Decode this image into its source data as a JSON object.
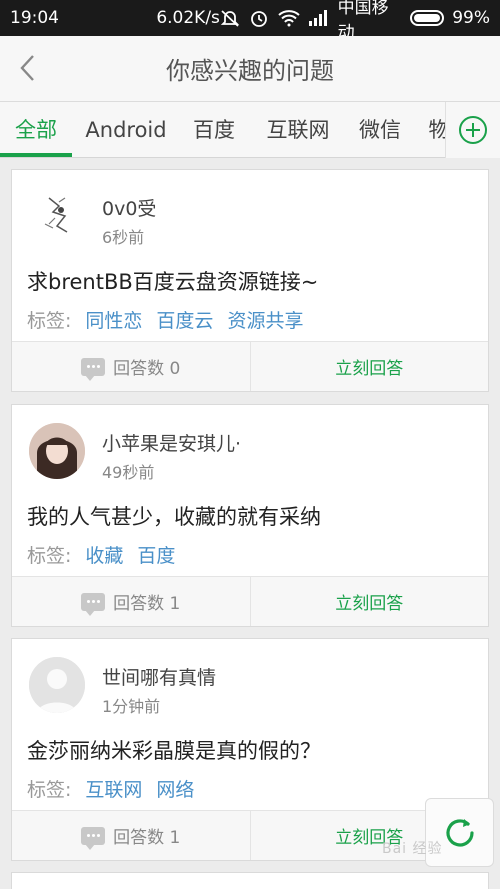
{
  "status_bar": {
    "time": "19:04",
    "speed": "6.02K/s",
    "carrier": "中国移动",
    "battery": "99%"
  },
  "header": {
    "title": "你感兴趣的问题"
  },
  "tabs": [
    {
      "label": "全部",
      "active": true
    },
    {
      "label": "Android"
    },
    {
      "label": "百度"
    },
    {
      "label": "互联网"
    },
    {
      "label": "微信"
    },
    {
      "label": "物"
    }
  ],
  "questions": [
    {
      "user": "0v0受",
      "time": "6秒前",
      "title": "求brentBB百度云盘资源链接~",
      "tag_label": "标签:",
      "tags": [
        "同性恋",
        "百度云",
        "资源共享"
      ],
      "answers_label": "回答数 0",
      "answer_action": "立刻回答"
    },
    {
      "user": "小苹果是安琪儿·",
      "time": "49秒前",
      "title": "我的人气甚少，收藏的就有采纳",
      "tag_label": "标签:",
      "tags": [
        "收藏",
        "百度"
      ],
      "answers_label": "回答数 1",
      "answer_action": "立刻回答"
    },
    {
      "user": "世间哪有真情",
      "time": "1分钟前",
      "title": "金莎丽纳米彩晶膜是真的假的？",
      "tag_label": "标签:",
      "tags": [
        "互联网",
        "网络"
      ],
      "answers_label": "回答数 1",
      "answer_action": "立刻回答"
    }
  ],
  "watermark": "Bai  经验",
  "colors": {
    "accent": "#1aa14a",
    "tag": "#4a90c8"
  }
}
